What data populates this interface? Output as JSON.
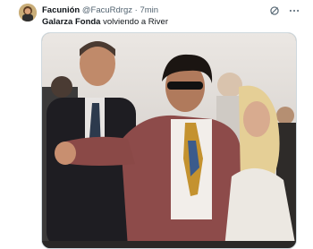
{
  "tweet": {
    "display_name": "Facunión",
    "handle": "@FacuRdrgz",
    "separator": "·",
    "time": "7min",
    "text_bold": "Galarza Fonda",
    "text_rest": " volviendo a River"
  },
  "icons": {
    "avatar": "avatar-image",
    "grok": "grok-icon",
    "more": "more-icon"
  },
  "colors": {
    "name_text": "#0f1419",
    "meta_text": "#536471",
    "media_border": "#cfd9de"
  }
}
